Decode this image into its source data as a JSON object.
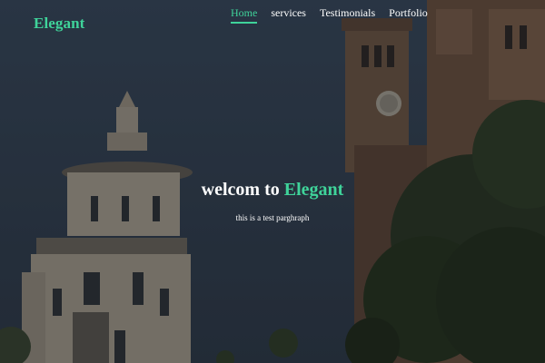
{
  "brand": {
    "logo": "Elegant"
  },
  "nav": {
    "items": [
      {
        "label": "Home",
        "active": true
      },
      {
        "label": "services",
        "active": false
      },
      {
        "label": "Testimonials",
        "active": false
      },
      {
        "label": "Portfolio",
        "active": false
      }
    ]
  },
  "hero": {
    "headline_prefix": "welcom to",
    "headline_brand": "Elegant",
    "subtitle": "this is a test parghraph"
  },
  "colors": {
    "accent": "#3fd39a",
    "text": "#ffffff",
    "sky": "#2f3d4e"
  }
}
